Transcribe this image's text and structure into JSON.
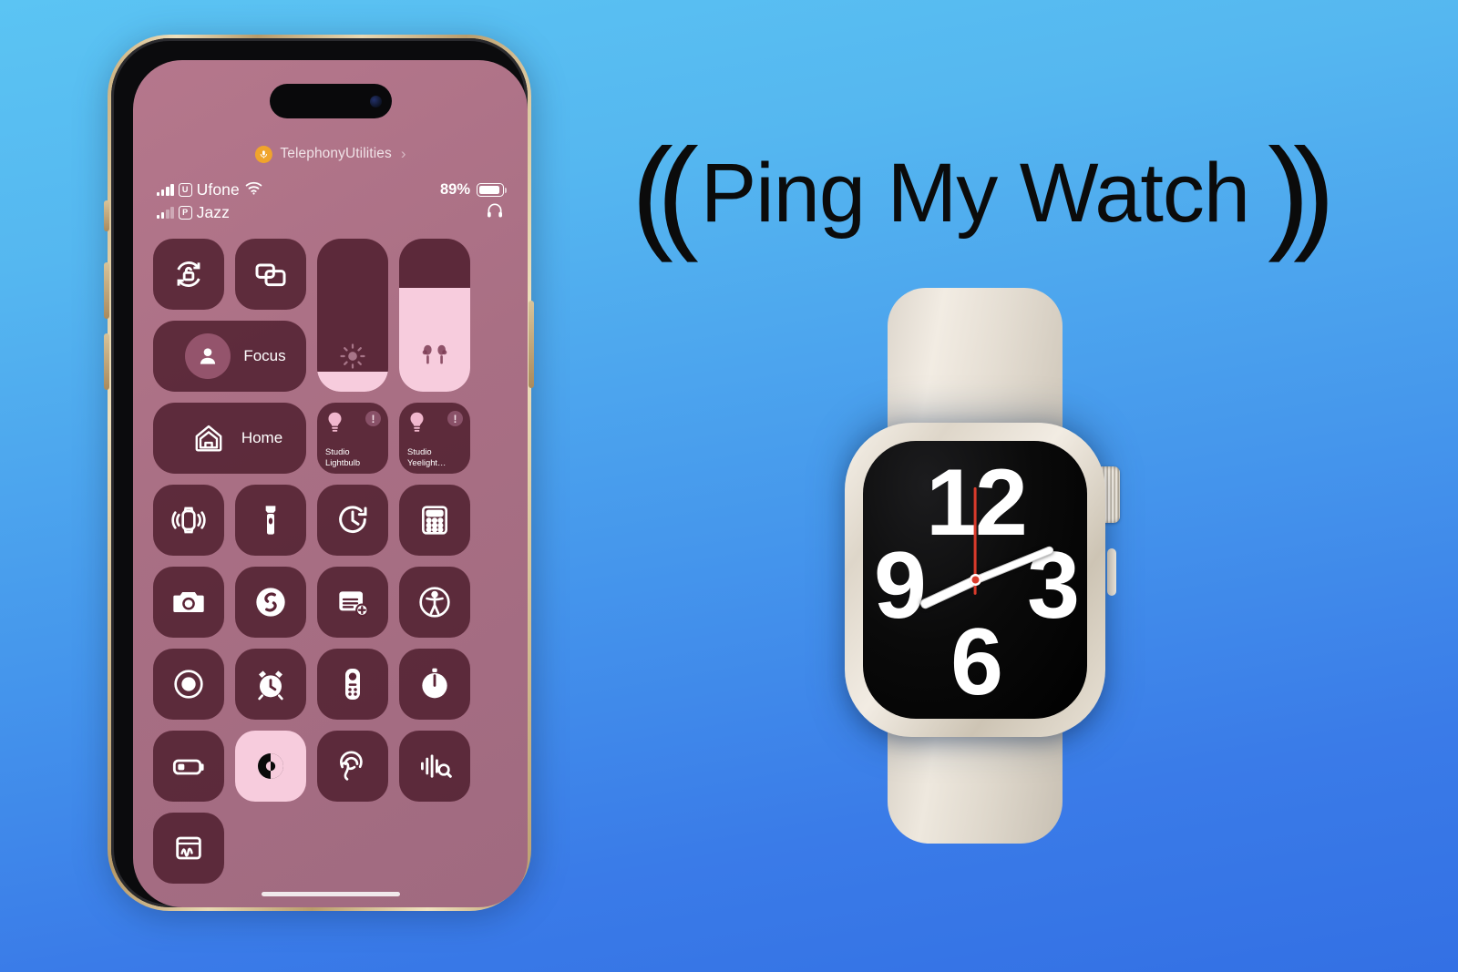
{
  "background": {
    "gradient_top": "#5BC4F3",
    "gradient_bottom": "#3370E4"
  },
  "title": {
    "text": "Ping My Watch",
    "left_arc": "((",
    "right_arc": "))",
    "color": "#0B0B0B"
  },
  "phone": {
    "app_pill": {
      "label": "TelephonyUtilities",
      "chevron": "›",
      "indicator_icon": "microphone-icon",
      "indicator_color": "#F0A42C"
    },
    "status_bar": {
      "sim1": {
        "badge": "U",
        "carrier": "Ufone",
        "signal_bars": 4,
        "wifi": true
      },
      "sim2": {
        "badge": "P",
        "carrier": "Jazz",
        "signal_bars": 2,
        "wifi": false
      },
      "battery_percent": "89%",
      "battery_level": 89,
      "headphones_icon": "headphones-icon"
    },
    "control_center": {
      "row1": [
        {
          "name": "rotation-lock",
          "icon": "rotation-lock-icon",
          "state": "off"
        },
        {
          "name": "screen-mirroring",
          "icon": "screen-mirroring-icon",
          "state": "off"
        }
      ],
      "brightness": {
        "label": "Brightness",
        "icon": "brightness-icon",
        "value": 13
      },
      "volume": {
        "label": "Volume",
        "icon": "airpods-icon",
        "value": 68
      },
      "focus": {
        "label": "Focus",
        "icon": "person-icon"
      },
      "home": {
        "label": "Home",
        "icon": "house-icon"
      },
      "accessories": [
        {
          "label": "Studio Lightbulb",
          "icon": "lightbulb-icon",
          "badge": "!"
        },
        {
          "label": "Studio Yeelight…",
          "icon": "lightbulb-icon",
          "badge": "!"
        }
      ],
      "grid": [
        [
          {
            "name": "ping-my-watch",
            "icon": "ping-watch-icon",
            "state": "off"
          },
          {
            "name": "flashlight",
            "icon": "flashlight-icon",
            "state": "off"
          },
          {
            "name": "timer",
            "icon": "timer-icon",
            "state": "off"
          },
          {
            "name": "calculator",
            "icon": "calculator-icon",
            "state": "off"
          }
        ],
        [
          {
            "name": "camera",
            "icon": "camera-icon",
            "state": "off"
          },
          {
            "name": "shazam",
            "icon": "shazam-icon",
            "state": "off"
          },
          {
            "name": "quick-note",
            "icon": "quick-note-icon",
            "state": "off"
          },
          {
            "name": "accessibility",
            "icon": "accessibility-icon",
            "state": "off"
          }
        ],
        [
          {
            "name": "screen-record",
            "icon": "screen-record-icon",
            "state": "off"
          },
          {
            "name": "alarm",
            "icon": "alarm-clock-icon",
            "state": "off"
          },
          {
            "name": "apple-tv-remote",
            "icon": "remote-icon",
            "state": "off"
          },
          {
            "name": "stopwatch",
            "icon": "stopwatch-icon",
            "state": "off"
          }
        ],
        [
          {
            "name": "low-power-mode",
            "icon": "battery-low-icon",
            "state": "off"
          },
          {
            "name": "dark-mode",
            "icon": "dark-mode-icon",
            "state": "on"
          },
          {
            "name": "hearing",
            "icon": "ear-icon",
            "state": "off"
          },
          {
            "name": "sound-recognition",
            "icon": "sound-recognition-icon",
            "state": "off"
          }
        ],
        [
          {
            "name": "stocks-widget",
            "icon": "stocks-icon",
            "state": "off"
          }
        ]
      ],
      "tile_color": "#4A1A29",
      "active_tile_color": "#F7CCDD"
    }
  },
  "watch": {
    "case_finish": "Starlight Aluminum",
    "band_color": "#EFE9E0",
    "face": {
      "numerals": {
        "twelve": "12",
        "three": "3",
        "six": "6",
        "nine": "9"
      },
      "hour_hand_deg": -115,
      "minute_hand_deg": 68,
      "second_hand_deg": 180,
      "second_hand_color": "#D93A2B",
      "background": "#000000"
    },
    "crown": "digital-crown",
    "side_button": "side-button"
  }
}
